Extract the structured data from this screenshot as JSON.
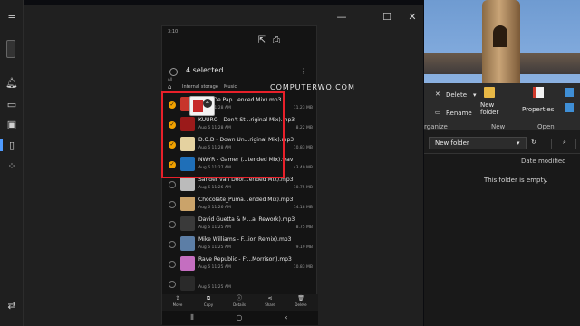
{
  "colors": {
    "accent": "#f0a100",
    "annotation": "#e8202a"
  },
  "phone": {
    "status_time": "3:10",
    "selected_count_text": "4 selected",
    "select_all_label": "All",
    "path": [
      "Internal storage",
      "Music"
    ],
    "files": [
      {
        "name": "Alice De Pap...enced Mix).mp3",
        "date": "Aug 6 11:28 AM",
        "size": "11.23 MB",
        "selected": true,
        "thumb": "#c7352b"
      },
      {
        "name": "KUURO - Don't St...riginal Mix).mp3",
        "date": "Aug 6 11:28 AM",
        "size": "8.22 MB",
        "selected": true,
        "thumb": "#9b1a1a"
      },
      {
        "name": "D.O.D - Down Un...riginal Mix).mp3",
        "date": "Aug 6 11:28 AM",
        "size": "10.83 MB",
        "selected": true,
        "thumb": "#e5d2a0"
      },
      {
        "name": "NWYR - Gamer (...tended Mix).wav",
        "date": "Aug 6 11:27 AM",
        "size": "43.40 MB",
        "selected": true,
        "thumb": "#1f6fb8"
      },
      {
        "name": "Sander van Door...ended Mix).mp3",
        "date": "Aug 6 11:26 AM",
        "size": "10.75 MB",
        "selected": false,
        "thumb": "#bbbbbb"
      },
      {
        "name": "Chocolate_Puma...ended Mix).mp3",
        "date": "Aug 6 11:26 AM",
        "size": "14.18 MB",
        "selected": false,
        "thumb": "#caa36a"
      },
      {
        "name": "David Guetta & M...al Rework).mp3",
        "date": "Aug 6 11:25 AM",
        "size": "8.75 MB",
        "selected": false,
        "thumb": "#3a3a3a"
      },
      {
        "name": "Mike Williams - F...ion Remix).mp3",
        "date": "Aug 6 11:25 AM",
        "size": "9.19 MB",
        "selected": false,
        "thumb": "#5c7ea6"
      },
      {
        "name": "Rave Republic - Fr...Morrison).mp3",
        "date": "Aug 6 11:25 AM",
        "size": "10.83 MB",
        "selected": false,
        "thumb": "#c46ec0"
      },
      {
        "name": "",
        "date": "Aug 6 11:25 AM",
        "size": "",
        "selected": false,
        "thumb": "#2a2a2a"
      }
    ],
    "bottom_actions": [
      "Move",
      "Copy",
      "Details",
      "Share",
      "Delete"
    ]
  },
  "drag": {
    "count": "4"
  },
  "watermark": "COMPUTERWO.COM",
  "explorer": {
    "ribbon": {
      "delete_label": "Delete",
      "rename_label": "Rename",
      "new_folder_label": "New folder",
      "properties_label": "Properties",
      "organize_group": "rganize",
      "new_group": "New",
      "open_group": "Open"
    },
    "address": "New folder",
    "column_date": "Date modified",
    "empty_text": "This folder is empty."
  }
}
